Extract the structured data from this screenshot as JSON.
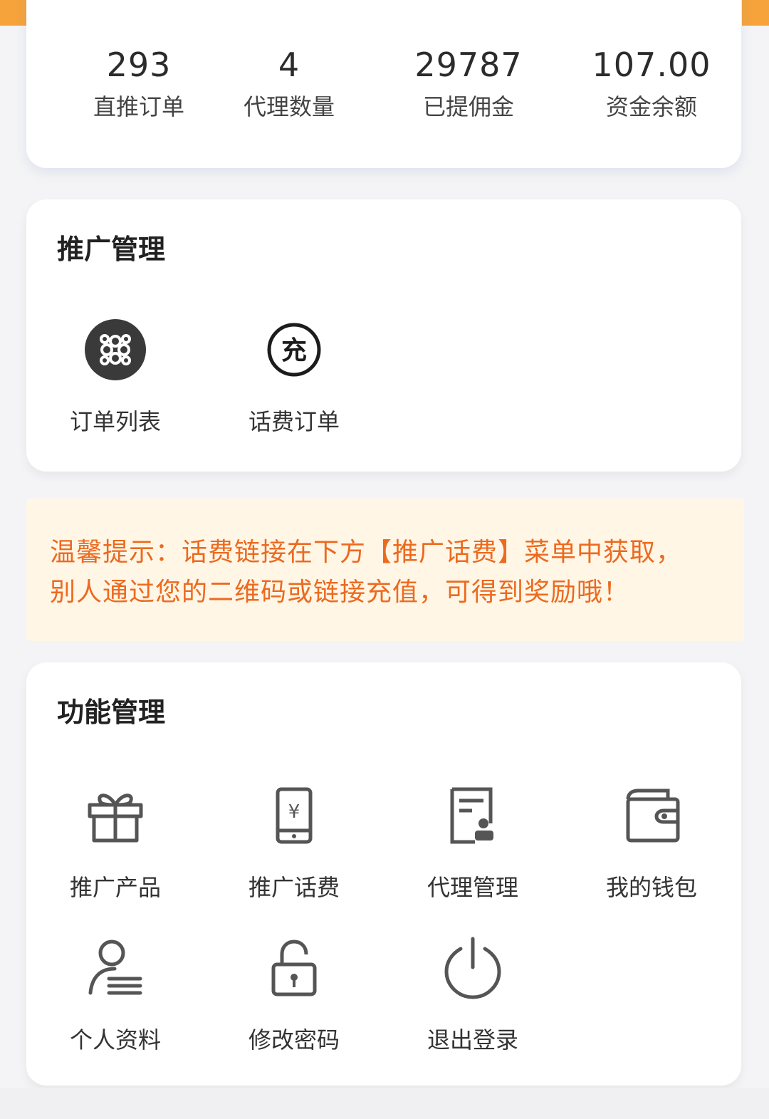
{
  "stats": [
    {
      "value": "293",
      "label": "直推订单"
    },
    {
      "value": "4",
      "label": "代理数量"
    },
    {
      "value": "29787",
      "label": "已提佣金"
    },
    {
      "value": "107.00",
      "label": "资金余额"
    }
  ],
  "promo": {
    "title": "推广管理",
    "items": [
      {
        "label": "订单列表",
        "icon": "unicom-logo-icon"
      },
      {
        "label": "话费订单",
        "icon": "recharge-icon"
      }
    ]
  },
  "notice": {
    "line1": "温馨提示：话费链接在下方【推广话费】菜单中获取，",
    "line2": "别人通过您的二维码或链接充值，可得到奖励哦！"
  },
  "functions": {
    "title": "功能管理",
    "items": [
      {
        "label": "推广产品",
        "icon": "gift-icon"
      },
      {
        "label": "推广话费",
        "icon": "phone-yuan-icon"
      },
      {
        "label": "代理管理",
        "icon": "document-user-icon"
      },
      {
        "label": "我的钱包",
        "icon": "wallet-icon"
      },
      {
        "label": "个人资料",
        "icon": "profile-icon"
      },
      {
        "label": "修改密码",
        "icon": "unlock-icon"
      },
      {
        "label": "退出登录",
        "icon": "power-icon"
      }
    ]
  },
  "colors": {
    "accent": "#f5a33a",
    "notice_text": "#ec6a1f",
    "notice_bg": "#fff6e6"
  }
}
